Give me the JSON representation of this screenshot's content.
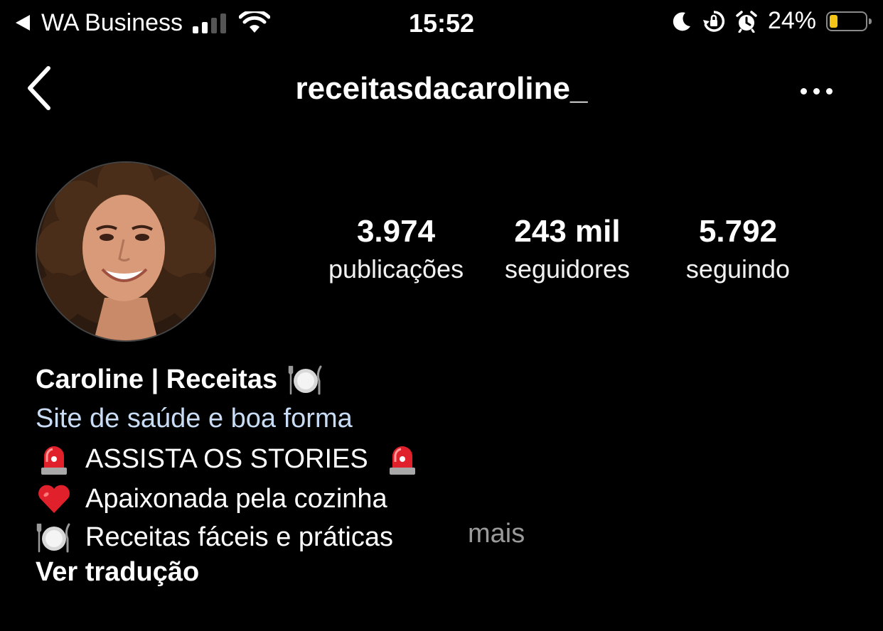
{
  "status_bar": {
    "back_app": "WA Business",
    "time": "15:52",
    "battery_percent": "24%",
    "battery_level": 0.24,
    "icons": [
      "back-triangle-icon",
      "cell-signal-icon",
      "wifi-icon",
      "moon-icon",
      "orientation-lock-icon",
      "alarm-icon",
      "battery-icon"
    ]
  },
  "header": {
    "username": "receitasdacaroline_",
    "back_icon": "chevron-left-icon",
    "more_icon": "more-horizontal-icon"
  },
  "profile": {
    "avatar": "profile-photo",
    "stats": [
      {
        "value": "3.974",
        "label": "publicações"
      },
      {
        "value": "243 mil",
        "label": "seguidores"
      },
      {
        "value": "5.792",
        "label": "seguindo"
      }
    ]
  },
  "bio": {
    "display_name": "Caroline | Receitas",
    "category": "Site de saúde e boa forma",
    "lines": [
      {
        "icon": "siren-emoji",
        "text": "ASSISTA OS STORIES"
      },
      {
        "icon": "red-heart-emoji",
        "text": "Apaixonada pela cozinha"
      },
      {
        "icon": "fork-knife-plate-emoji",
        "text": "Receitas fáceis e práticas"
      }
    ],
    "more_label": "mais",
    "translate_label": "Ver tradução"
  },
  "colors": {
    "background": "#000000",
    "text": "#ffffff",
    "category_text": "#c9dcf5",
    "muted": "#9a9a9a",
    "battery_fill": "#f5c518"
  }
}
